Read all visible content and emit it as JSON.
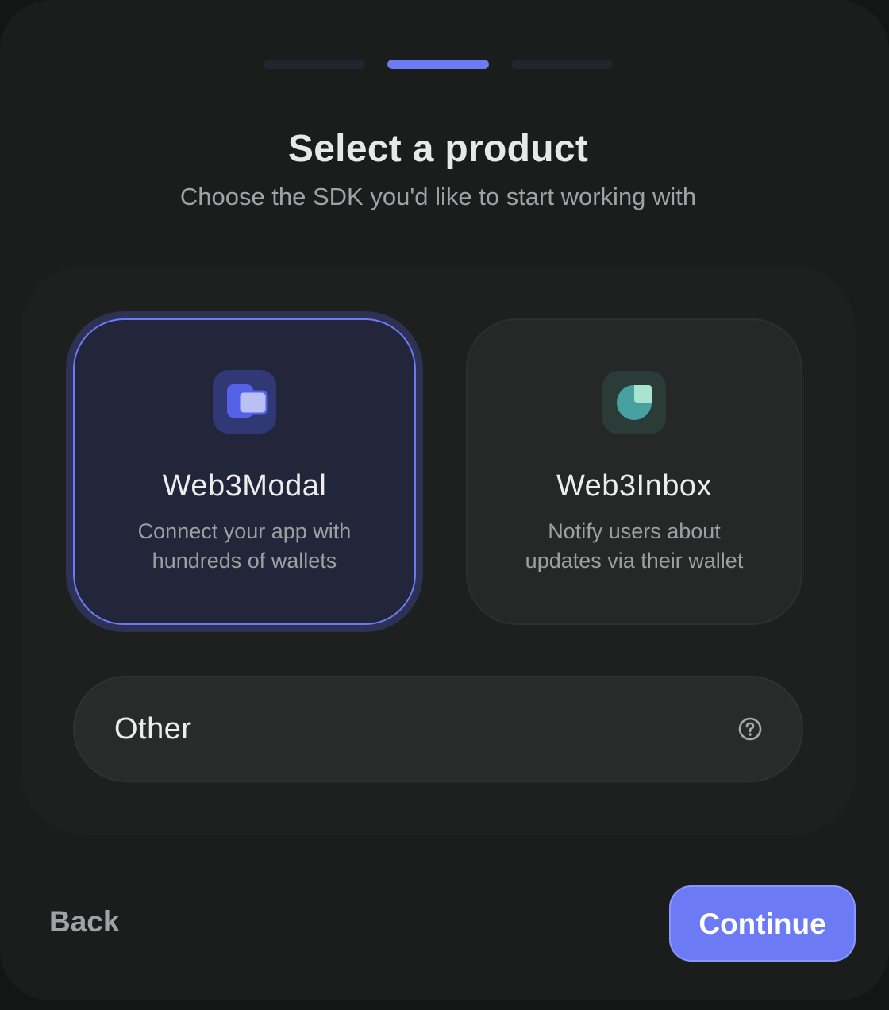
{
  "colors": {
    "accent": "#6c7bf5",
    "background": "#1b1c1c",
    "modal_icon_bg": "#303976",
    "inbox_icon_bg": "#2b3b37",
    "inbox_icon": "#47a1a0"
  },
  "progress": {
    "total_steps": 3,
    "current_step": 2
  },
  "header": {
    "title": "Select a product",
    "subtitle": "Choose the SDK you'd like to start working with"
  },
  "products": [
    {
      "name": "Web3Modal",
      "description_line1": "Connect your app with",
      "description_line2": "hundreds of wallets",
      "icon": "stacked-squares-icon",
      "selected": true
    },
    {
      "name": "Web3Inbox",
      "description_line1": "Notify users about",
      "description_line2": "updates via their wallet",
      "icon": "inbox-circle-icon",
      "selected": false
    }
  ],
  "other": {
    "label": "Other",
    "icon": "help-circle-icon"
  },
  "footer": {
    "back_label": "Back",
    "continue_label": "Continue"
  }
}
